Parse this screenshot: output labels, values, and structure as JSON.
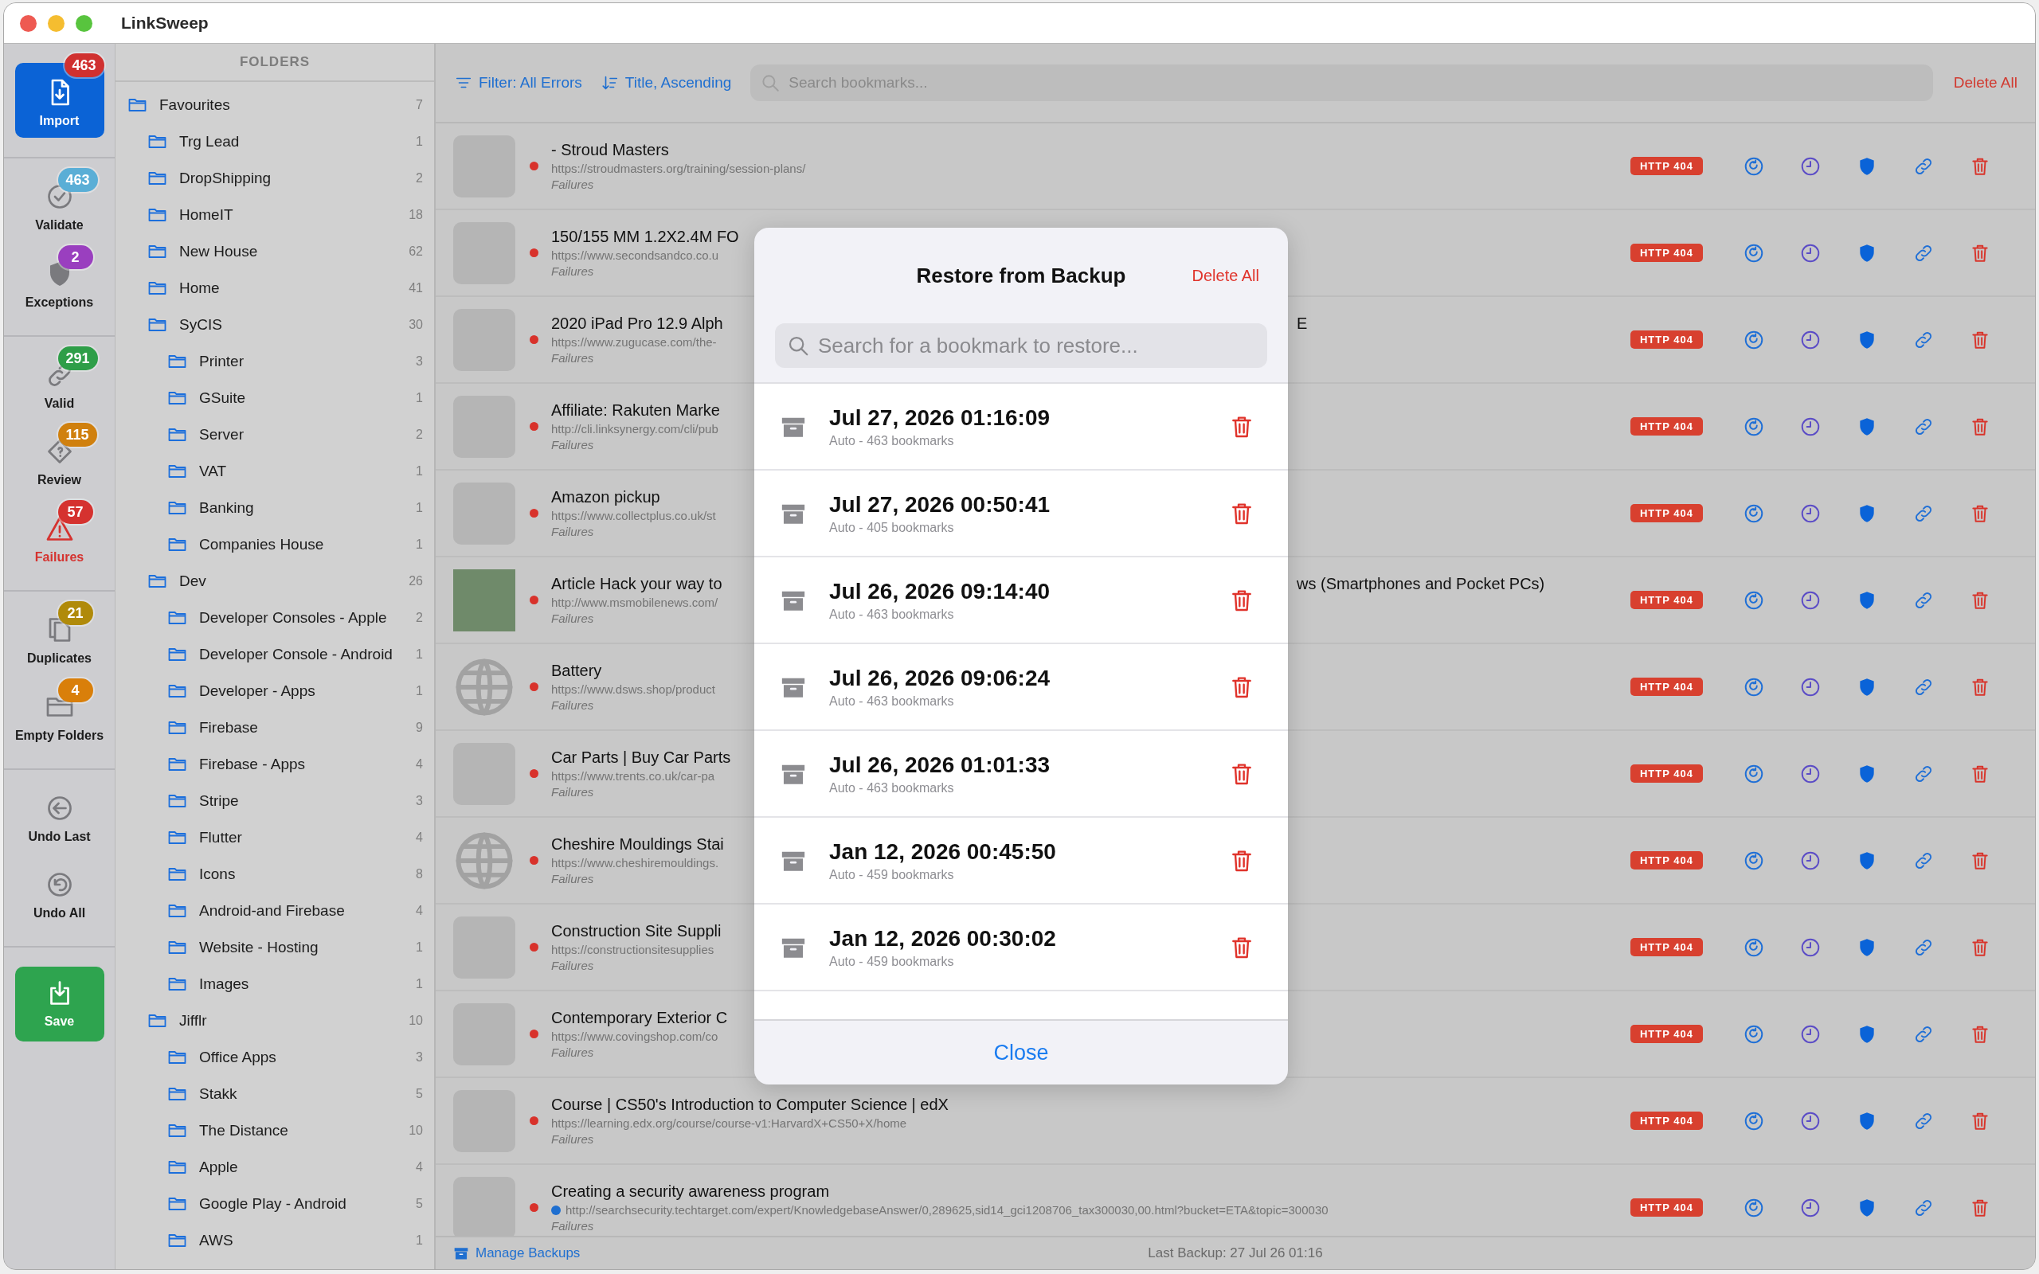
{
  "window": {
    "title": "LinkSweep"
  },
  "rail": [
    {
      "items": [
        {
          "label": "Import",
          "kind": "primary",
          "badge": "463",
          "color": "#d0302f",
          "selected": false
        }
      ]
    },
    {
      "items": [
        {
          "label": "Validate",
          "kind": "plain",
          "badge": "463",
          "color": "#5aaed6",
          "selected": false
        },
        {
          "label": "Exceptions",
          "kind": "plain",
          "badge": "2",
          "color": "#9a3fbf",
          "selected": false
        }
      ]
    },
    {
      "items": [
        {
          "label": "Valid",
          "kind": "plain",
          "badge": "291",
          "color": "#2e9e48",
          "selected": false
        },
        {
          "label": "Review",
          "kind": "plain",
          "badge": "115",
          "color": "#d0800e",
          "selected": false
        },
        {
          "label": "Failures",
          "kind": "plain",
          "badge": "57",
          "color": "#d5322f",
          "selected": true
        }
      ]
    },
    {
      "items": [
        {
          "label": "Duplicates",
          "kind": "plain",
          "badge": "21",
          "color": "#b08a0a",
          "selected": false
        },
        {
          "label": "Empty Folders",
          "kind": "plain",
          "badge": "4",
          "color": "#d97f0a",
          "selected": false
        }
      ]
    },
    {
      "items": [
        {
          "label": "Undo Last",
          "kind": "plain",
          "selected": false
        },
        {
          "label": "Undo All",
          "kind": "plain",
          "selected": false
        }
      ]
    },
    {
      "items": [
        {
          "label": "Save",
          "kind": "save",
          "selected": false
        }
      ]
    }
  ],
  "folders": {
    "title": "FOLDERS",
    "items": [
      {
        "name": "Favourites",
        "count": "7",
        "children": [
          {
            "name": "Trg Lead",
            "count": "1"
          },
          {
            "name": "DropShipping",
            "count": "2"
          },
          {
            "name": "HomeIT",
            "count": "18"
          },
          {
            "name": "New House",
            "count": "62"
          },
          {
            "name": "Home",
            "count": "41"
          },
          {
            "name": "SyCIS",
            "count": "30",
            "children": [
              {
                "name": "Printer",
                "count": "3"
              },
              {
                "name": "GSuite",
                "count": "1"
              },
              {
                "name": "Server",
                "count": "2"
              },
              {
                "name": "VAT",
                "count": "1"
              },
              {
                "name": "Banking",
                "count": "1"
              },
              {
                "name": "Companies House",
                "count": "1"
              }
            ]
          },
          {
            "name": "Dev",
            "count": "26",
            "children": [
              {
                "name": "Developer Consoles - Apple",
                "count": "2"
              },
              {
                "name": "Developer Console - Android",
                "count": "1"
              },
              {
                "name": "Developer - Apps",
                "count": "1"
              },
              {
                "name": "Firebase",
                "count": "9"
              },
              {
                "name": "Firebase - Apps",
                "count": "4"
              },
              {
                "name": "Stripe",
                "count": "3"
              },
              {
                "name": "Flutter",
                "count": "4"
              },
              {
                "name": "Icons",
                "count": "8"
              },
              {
                "name": "Android-and Firebase",
                "count": "4"
              },
              {
                "name": "Website - Hosting",
                "count": "1"
              },
              {
                "name": "Images",
                "count": "1"
              }
            ]
          },
          {
            "name": "Jifflr",
            "count": "10",
            "children": [
              {
                "name": "Office Apps",
                "count": "3"
              },
              {
                "name": "Stakk",
                "count": "5"
              },
              {
                "name": "The Distance",
                "count": "10"
              },
              {
                "name": "Apple",
                "count": "4"
              },
              {
                "name": "Google Play - Android",
                "count": "5"
              },
              {
                "name": "AWS",
                "count": "1"
              }
            ]
          }
        ]
      }
    ]
  },
  "toolbar": {
    "filter": "Filter: All Errors",
    "sort": "Title, Ascending",
    "search_placeholder": "Search bookmarks...",
    "delete_all": "Delete All"
  },
  "bookmarks": [
    {
      "kind": "logo",
      "title": "- Stroud Masters",
      "url": "https://stroudmasters.org/training/session-plans/",
      "category": "Failures",
      "status": "HTTP 404"
    },
    {
      "kind": "logo",
      "title": "150/155 MM 1.2X2.4M FO",
      "url": "https://www.secondsandco.co.u",
      "category": "Failures",
      "status": "HTTP 404"
    },
    {
      "kind": "logo",
      "title": "2020 iPad Pro 12.9 Alph",
      "tail": "E",
      "url": "https://www.zugucase.com/the-",
      "category": "Failures",
      "status": "HTTP 404"
    },
    {
      "kind": "logo",
      "title": "Affiliate: Rakuten Marke",
      "url": "http://cli.linksynergy.com/cli/pub",
      "category": "Failures",
      "status": "HTTP 404"
    },
    {
      "kind": "logo",
      "title": "Amazon pickup",
      "url": "https://www.collectplus.co.uk/st",
      "category": "Failures",
      "status": "HTTP 404"
    },
    {
      "kind": "photo",
      "title": "Article Hack your way to",
      "tail": "ws (Smartphones and Pocket PCs)",
      "url": "http://www.msmobilenews.com/",
      "category": "Failures",
      "status": "HTTP 404"
    },
    {
      "kind": "globe",
      "title": "Battery",
      "url": "https://www.dsws.shop/product",
      "category": "Failures",
      "status": "HTTP 404"
    },
    {
      "kind": "logo",
      "title": "Car Parts | Buy Car Parts",
      "url": "https://www.trents.co.uk/car-pa",
      "category": "Failures",
      "status": "HTTP 404"
    },
    {
      "kind": "globe",
      "title": "Cheshire Mouldings Stai",
      "url": "https://www.cheshiremouldings.",
      "category": "Failures",
      "status": "HTTP 404"
    },
    {
      "kind": "logo",
      "title": "Construction Site Suppli",
      "url": "https://constructionsitesupplies",
      "category": "Failures",
      "status": "HTTP 404"
    },
    {
      "kind": "logo",
      "title": "Contemporary Exterior C",
      "url": "https://www.covingshop.com/co",
      "category": "Failures",
      "status": "HTTP 404"
    },
    {
      "kind": "logo",
      "title": "Course | CS50's Introduction to Computer Science | edX",
      "url": "https://learning.edx.org/course/course-v1:HarvardX+CS50+X/home",
      "category": "Failures",
      "status": "HTTP 404"
    },
    {
      "kind": "logo",
      "title": "Creating a security awareness program",
      "url": "http://searchsecurity.techtarget.com/expert/KnowledgebaseAnswer/0,289625,sid14_gci1208706_tax300030,00.html?bucket=ETA&topic=300030",
      "marker": true,
      "category": "Failures",
      "status": "HTTP 404"
    }
  ],
  "status_bar": {
    "manage": "Manage Backups",
    "last_backup": "Last Backup: 27 Jul 26 01:16"
  },
  "dialog": {
    "title": "Restore from Backup",
    "delete_all": "Delete All",
    "search_placeholder": "Search for a bookmark to restore...",
    "close": "Close",
    "backups": [
      {
        "date": "Jul 27, 2026 01:16:09",
        "detail": "Auto - 463 bookmarks"
      },
      {
        "date": "Jul 27, 2026 00:50:41",
        "detail": "Auto - 405 bookmarks"
      },
      {
        "date": "Jul 26, 2026 09:14:40",
        "detail": "Auto - 463 bookmarks"
      },
      {
        "date": "Jul 26, 2026 09:06:24",
        "detail": "Auto - 463 bookmarks"
      },
      {
        "date": "Jul 26, 2026 01:01:33",
        "detail": "Auto - 463 bookmarks"
      },
      {
        "date": "Jan 12, 2026 00:45:50",
        "detail": "Auto - 459 bookmarks"
      },
      {
        "date": "Jan 12, 2026 00:30:02",
        "detail": "Auto - 459 bookmarks"
      }
    ]
  }
}
